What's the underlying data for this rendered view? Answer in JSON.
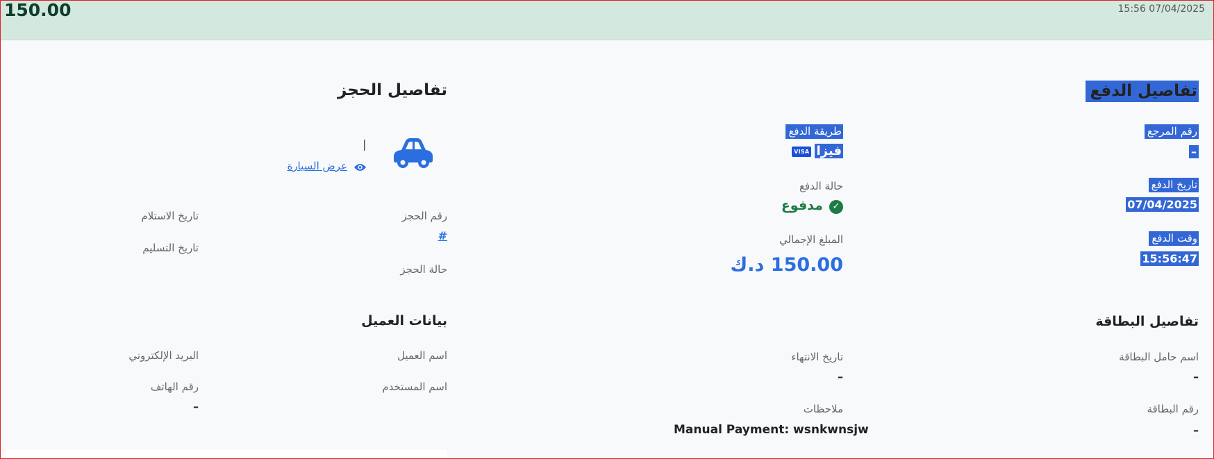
{
  "topbar": {
    "amount": "150.00",
    "datetime": "15:56 07/04/2025"
  },
  "payment": {
    "title": "تفاصيل الدفع",
    "reference": {
      "label": "رقم المرجع",
      "value": "–"
    },
    "date": {
      "label": "تاريخ الدفع",
      "value": "07/04/2025"
    },
    "time": {
      "label": "وقت الدفع",
      "value": "15:56:47"
    },
    "method": {
      "label": "طريقة الدفع",
      "value": "فيزا",
      "badge": "VISA"
    },
    "status": {
      "label": "حالة الدفع",
      "value": "مدفوع"
    },
    "total": {
      "label": "المبلغ الإجمالي",
      "value": "150.00 د.ك"
    }
  },
  "card": {
    "title": "تفاصيل البطاقة",
    "holder": {
      "label": "اسم حامل البطاقة",
      "value": "–"
    },
    "number": {
      "label": "رقم البطاقة",
      "value": "–"
    },
    "expiry": {
      "label": "تاريخ الانتهاء",
      "value": "–"
    },
    "notes": {
      "label": "ملاحظات",
      "value": "Manual Payment: wsnkwnsjw"
    }
  },
  "booking": {
    "title": "تفاصيل الحجز",
    "car_name": "|",
    "view_car_label": "عرض السيارة",
    "booking_number": {
      "label": "رقم الحجز",
      "value": "#"
    },
    "booking_status": {
      "label": "حالة الحجز"
    },
    "pickup_date": {
      "label": "تاريخ الاستلام"
    },
    "delivery_date": {
      "label": "تاريخ التسليم"
    }
  },
  "customer": {
    "title": "بيانات العميل",
    "name": {
      "label": "اسم العميل"
    },
    "username": {
      "label": "اسم المستخدم"
    },
    "email": {
      "label": "البريد الإلكتروني"
    },
    "phone": {
      "label": "رقم الهاتف",
      "value": "–"
    }
  },
  "colors": {
    "accent": "#2a6ee0",
    "paid": "#1e7b45",
    "topbar": "#d3e8de",
    "selection": "#3367d6"
  },
  "icons": {
    "car": "car-icon",
    "eye": "eye-icon",
    "check": "check-circle-icon",
    "visa": "visa-card-icon"
  }
}
